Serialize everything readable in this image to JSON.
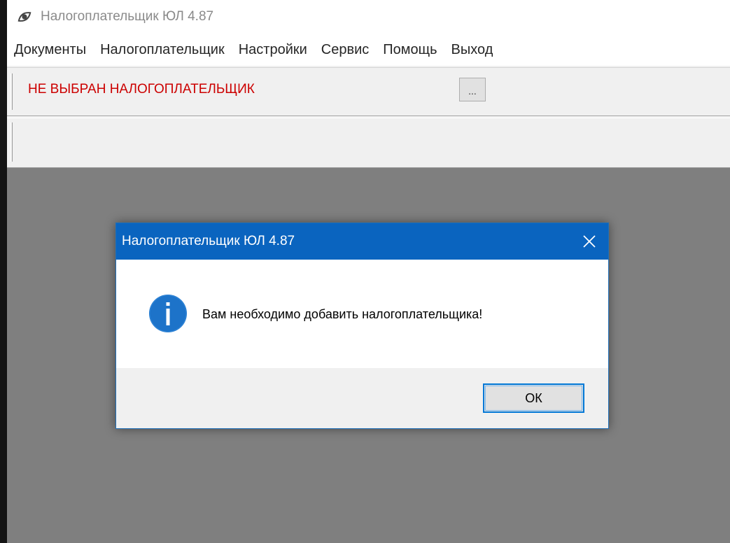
{
  "window": {
    "title": "Налогоплательщик ЮЛ 4.87",
    "icon": "app-eye-icon"
  },
  "menu": {
    "items": [
      {
        "label": "Документы"
      },
      {
        "label": "Налогоплательщик"
      },
      {
        "label": "Настройки"
      },
      {
        "label": "Сервис"
      },
      {
        "label": "Помощь"
      },
      {
        "label": "Выход"
      }
    ]
  },
  "toolbar": {
    "taxpayer_status": "НЕ ВЫБРАН НАЛОГОПЛАТЕЛЬЩИК",
    "taxpayer_status_color": "#cc0000",
    "browse_button_label": "..."
  },
  "dialog": {
    "title": "Налогоплательщик ЮЛ 4.87",
    "close_icon": "close-icon",
    "message_icon": "info-icon",
    "message": "Вам необходимо добавить налогоплательщика!",
    "ok_label": "ОК",
    "accent_color": "#0a64bf"
  },
  "colors": {
    "workspace_background": "#7f7f7f",
    "title_text": "#8a8a8a"
  }
}
